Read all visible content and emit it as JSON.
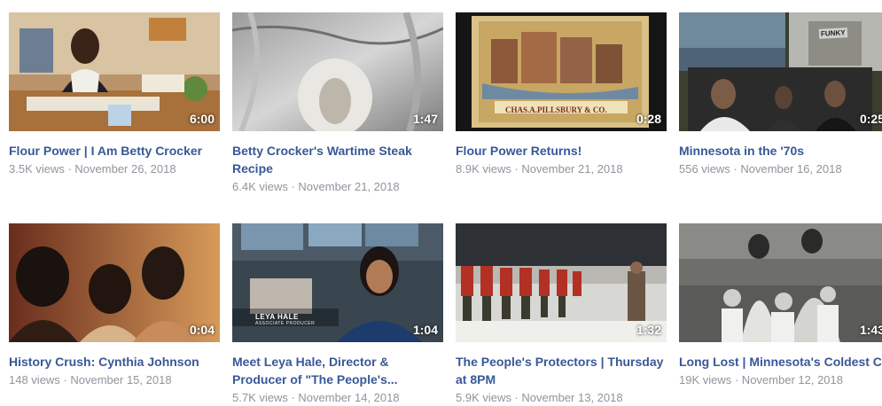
{
  "videos": [
    {
      "title": "Flour Power | I Am Betty Crocker",
      "meta": "3.5K views · November 26, 2018",
      "duration": "6:00",
      "thumb_icon": "betty-crocker-office-thumbnail"
    },
    {
      "title": "Betty Crocker's Wartime Steak Recipe",
      "meta": "6.4K views · November 21, 2018",
      "duration": "1:47",
      "thumb_icon": "foil-steak-thumbnail"
    },
    {
      "title": "Flour Power Returns!",
      "meta": "8.9K views · November 21, 2018",
      "duration": "0:28",
      "thumb_icon": "pillsbury-poster-thumbnail",
      "poster_text": "CHAS.A.PILLSBURY & CO."
    },
    {
      "title": "Minnesota in the '70s",
      "meta": "556 views · November 16, 2018",
      "duration": "0:25",
      "thumb_icon": "minnesota-70s-collage-thumbnail",
      "sign_text": "FUNKY"
    },
    {
      "title": "History Crush: Cynthia Johnson",
      "meta": "148 views · November 15, 2018",
      "duration": "0:04",
      "thumb_icon": "singers-thumbnail"
    },
    {
      "title": "Meet Leya Hale, Director & Producer of \"The People's...",
      "meta": "5.7K views · November 14, 2018",
      "duration": "1:04",
      "thumb_icon": "leya-hale-interview-thumbnail",
      "lower_third_name": "LEYA HALE",
      "lower_third_role": "ASSOCIATE PRODUCER"
    },
    {
      "title": "The People's Protectors | Thursday at 8PM",
      "meta": "5.9K views · November 13, 2018",
      "duration": "1:32",
      "thumb_icon": "veterans-ceremony-thumbnail"
    },
    {
      "title": "Long Lost | Minnesota's Coldest Case",
      "meta": "19K views · November 12, 2018",
      "duration": "1:43",
      "thumb_icon": "family-photo-thumbnail"
    }
  ],
  "colors": {
    "title": "#385898",
    "meta": "#90949c",
    "duration": "#ffffff"
  }
}
